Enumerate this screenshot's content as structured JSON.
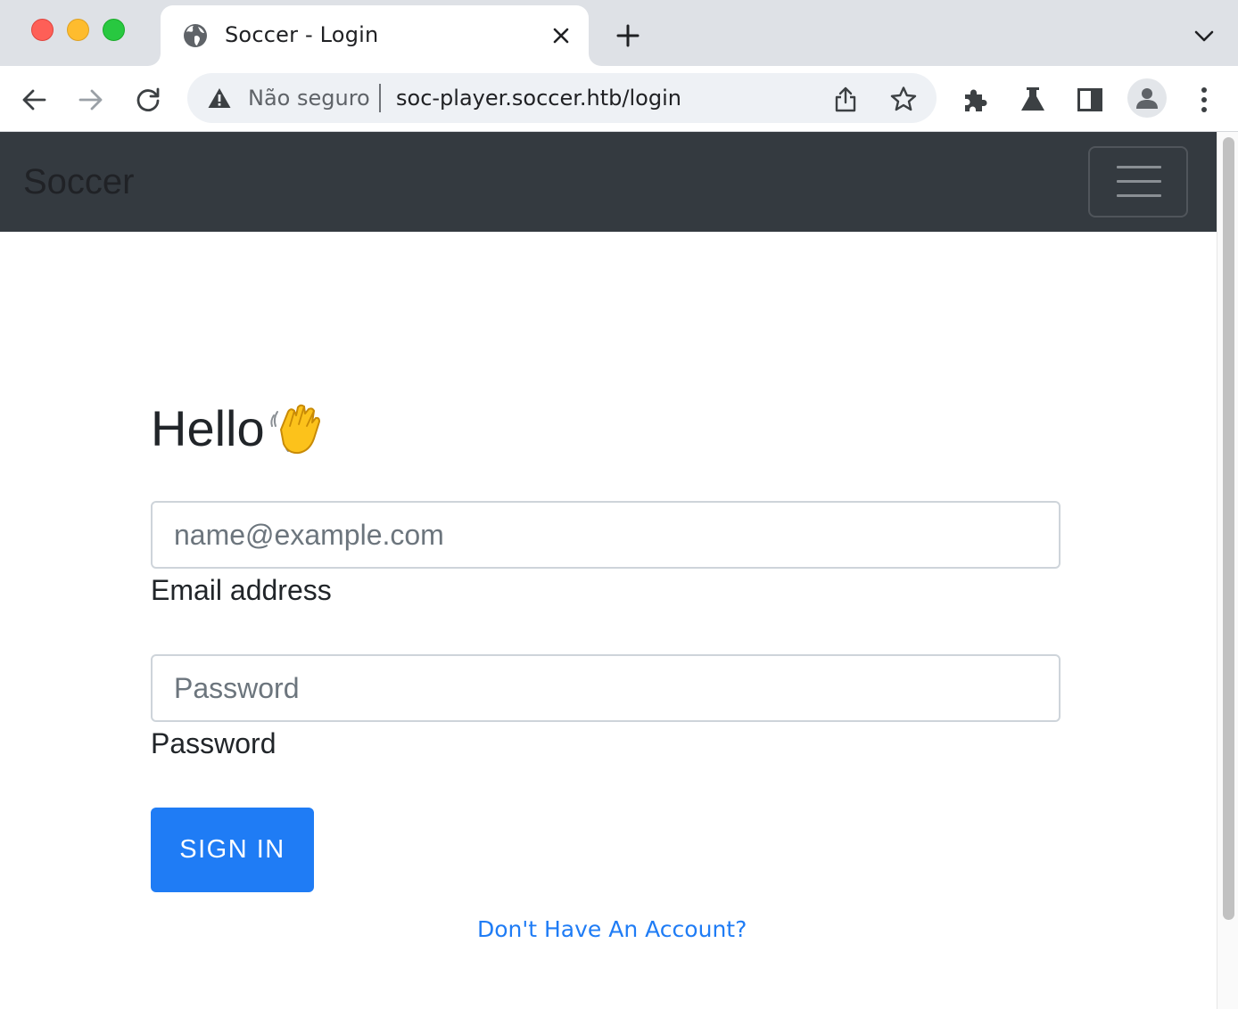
{
  "browser": {
    "tab": {
      "title": "Soccer - Login"
    },
    "address": {
      "security_label": "Não seguro",
      "url": "soc-player.soccer.htb/login"
    }
  },
  "navbar": {
    "brand": "Soccer"
  },
  "login": {
    "heading": "Hello",
    "email": {
      "placeholder": "name@example.com",
      "label": "Email address"
    },
    "password": {
      "placeholder": "Password",
      "label": "Password"
    },
    "sign_in_label": "SIGN IN",
    "register_link": "Don't Have An Account?"
  },
  "colors": {
    "navbar_bg": "#343a40",
    "primary": "#1f7cf5",
    "tabstrip_bg": "#dee1e6",
    "omnibox_bg": "#eef1f5"
  },
  "icons": {
    "tab_favicon": "globe-icon",
    "security": "warning-triangle-icon",
    "heading_emoji": "waving-hand-icon"
  }
}
